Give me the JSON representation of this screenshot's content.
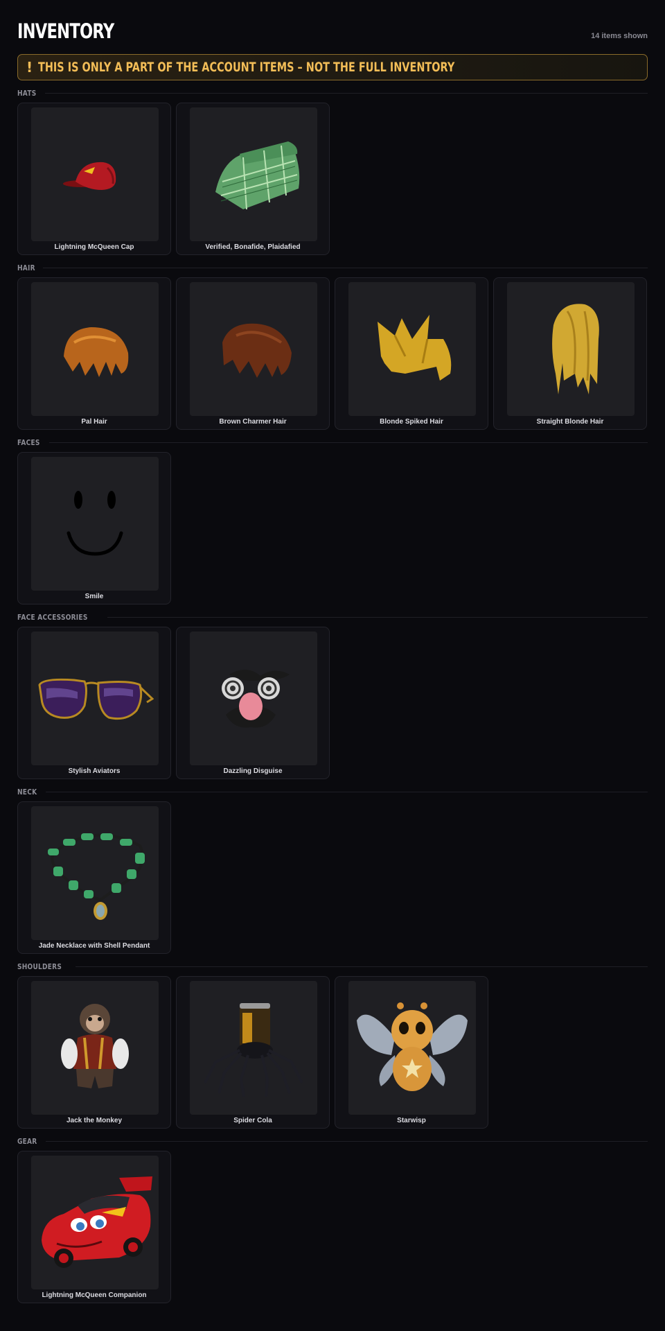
{
  "header": {
    "title": "INVENTORY",
    "count": "14 items shown"
  },
  "banner": {
    "icon": "exclamation-icon",
    "text": "THIS IS ONLY A PART OF THE ACCOUNT ITEMS – NOT THE FULL INVENTORY"
  },
  "colors": {
    "accent": "#f2bd57",
    "background": "#0a0a0e",
    "card": "#111116",
    "thumb": "#1f1f23"
  },
  "sections": [
    {
      "label": "HATS",
      "items": [
        {
          "name": "Lightning McQueen Cap",
          "icon": "red-cap-icon"
        },
        {
          "name": "Verified, Bonafide, Plaidafied",
          "icon": "plaid-cap-icon"
        }
      ]
    },
    {
      "label": "HAIR",
      "items": [
        {
          "name": "Pal Hair",
          "icon": "orange-hair-icon"
        },
        {
          "name": "Brown Charmer Hair",
          "icon": "brown-hair-icon"
        },
        {
          "name": "Blonde Spiked Hair",
          "icon": "spiked-hair-icon"
        },
        {
          "name": "Straight Blonde Hair",
          "icon": "straight-hair-icon"
        }
      ]
    },
    {
      "label": "FACES",
      "items": [
        {
          "name": "Smile",
          "icon": "smile-face-icon"
        }
      ]
    },
    {
      "label": "FACE ACCESSORIES",
      "items": [
        {
          "name": "Stylish Aviators",
          "icon": "aviators-icon"
        },
        {
          "name": "Dazzling Disguise",
          "icon": "disguise-glasses-icon"
        }
      ]
    },
    {
      "label": "NECK",
      "items": [
        {
          "name": "Jade Necklace with Shell Pendant",
          "icon": "jade-necklace-icon"
        }
      ]
    },
    {
      "label": "SHOULDERS",
      "items": [
        {
          "name": "Jack the Monkey",
          "icon": "monkey-icon"
        },
        {
          "name": "Spider Cola",
          "icon": "spider-cola-icon"
        },
        {
          "name": "Starwisp",
          "icon": "starwisp-icon"
        }
      ]
    },
    {
      "label": "GEAR",
      "items": [
        {
          "name": "Lightning McQueen Companion",
          "icon": "race-car-icon"
        }
      ]
    }
  ]
}
